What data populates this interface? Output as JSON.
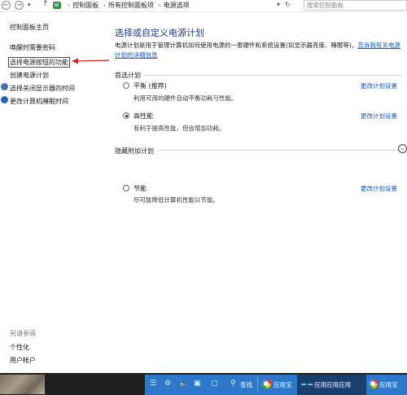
{
  "address_bar": {
    "back_icon": "left-arrow-icon",
    "forward_icon": "right-arrow-icon",
    "breadcrumbs": [
      "控制面板",
      "所有控制面板项",
      "电源选项"
    ],
    "search_placeholder": "搜索控制面板"
  },
  "sidebar": {
    "home_label": "控制面板主页",
    "items": [
      {
        "label": "唤醒时需要密码"
      },
      {
        "label": "选择电源按钮的功能"
      },
      {
        "label": "创建电源计划"
      },
      {
        "label": "选择关闭显示器的时间"
      },
      {
        "label": "更改计算机睡眠时间"
      }
    ],
    "see_also": {
      "heading": "另请参阅",
      "items": [
        "个性化",
        "用户帐户"
      ]
    }
  },
  "main": {
    "title": "选择或自定义电源计划",
    "description_line1": "电源计划是用于管理计算机如何使用电源的一套硬件和系统设置(如显示器亮度、睡眠等)。",
    "description_link": "告诉我有关电源计划的详细信息",
    "preferred_heading": "首选计划",
    "hidden_heading": "隐藏附加计划",
    "plans": [
      {
        "name": "平衡 (推荐)",
        "description": "利用可用的硬件自动平衡功耗与性能。",
        "link": "更改计划设置",
        "selected": false
      },
      {
        "name": "高性能",
        "description": "有利于提高性能，但会增加功耗。",
        "link": "更改计划设置",
        "selected": true
      },
      {
        "name": "节能",
        "description": "尽可能降低计算机性能以节能。",
        "link": "更改计划设置",
        "selected": false
      }
    ]
  },
  "taskbar": {
    "search_label": "查找",
    "app_label": "应用宝",
    "app_label_2": "应用宝",
    "running_label": "应用应用应用"
  }
}
